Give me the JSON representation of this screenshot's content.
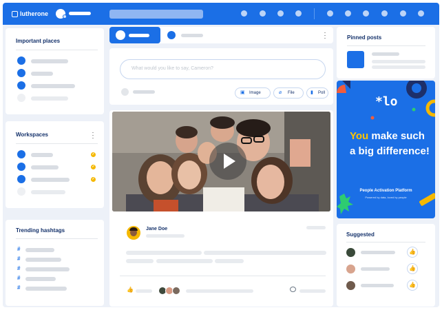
{
  "app": {
    "logo_text": "lutherone"
  },
  "sidebar": {
    "important_places_title": "Important places",
    "workspaces_title": "Workspaces",
    "workspaces_menu_icon": "more-vertical-icon",
    "trending_title": "Trending hashtags",
    "hash_symbol": "#"
  },
  "composer": {
    "placeholder": "What would you like to say, Cameron?",
    "image_label": "Image",
    "file_label": "File",
    "poll_label": "Poll"
  },
  "post": {
    "author": "Jane Doe",
    "video_state": "paused",
    "like_icon": "thumbs-up-icon",
    "comment_icon": "comment-icon"
  },
  "pinned": {
    "title": "Pinned posts"
  },
  "promo": {
    "logo_text": "*lo",
    "headline_highlight": "You",
    "headline_rest": " make such a big difference!",
    "subtitle": "People Activation Platform",
    "tagline": "Powered by data, loved by people",
    "colors": {
      "bg": "#1b6fe6",
      "highlight": "#ffc400",
      "accent_green": "#2ecc71",
      "accent_red": "#f25c3b"
    }
  },
  "suggested": {
    "title": "Suggested"
  },
  "colors": {
    "brand_blue": "#1b6fe6",
    "check_yellow": "#f5b800",
    "navy": "#15326b"
  }
}
